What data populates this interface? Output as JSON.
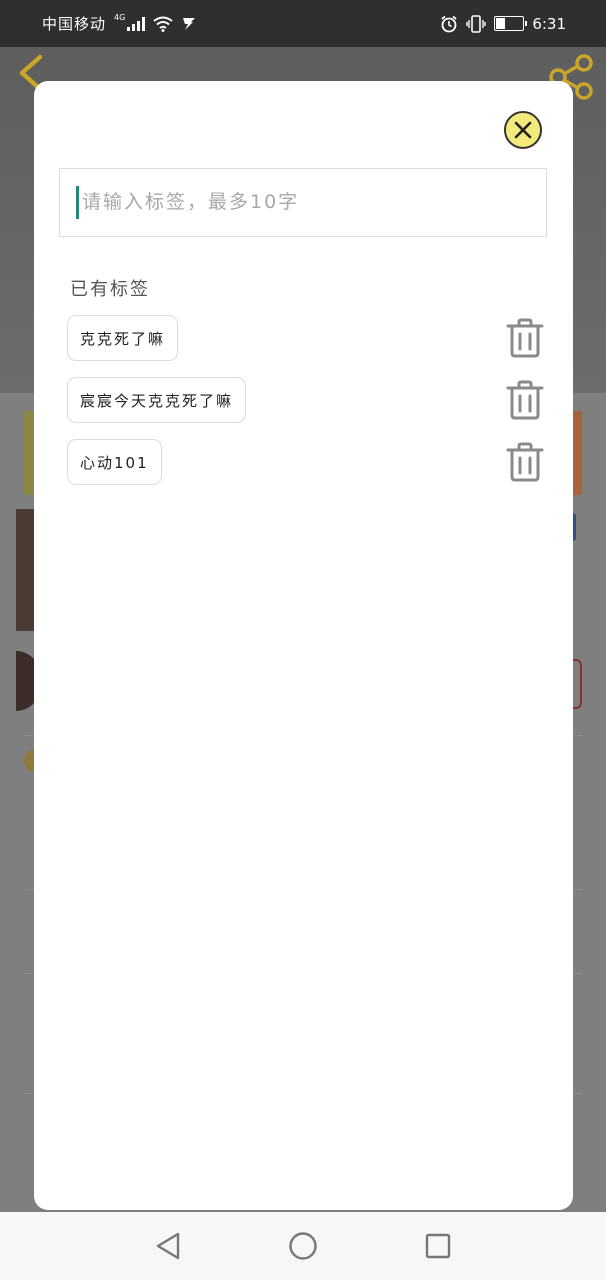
{
  "status_bar": {
    "carrier": "中国移动",
    "network": "4G",
    "time": "6:31",
    "battery_level": 0.3
  },
  "header": {
    "back_icon": "chevron-left-icon",
    "share_icon": "share-icon",
    "accent_color": "#f4c21a"
  },
  "modal": {
    "close_icon": "close-icon",
    "close_color": "#f2eb7c",
    "input": {
      "value": "",
      "placeholder": "请输入标签，最多10字"
    },
    "existing_title": "已有标签",
    "tags": [
      {
        "label": "克克死了嘛"
      },
      {
        "label": "宸宸今天克克死了嘛"
      },
      {
        "label": "心动101"
      }
    ],
    "delete_icon": "trash-icon"
  },
  "nav_bar": {
    "items": [
      "back-triangle-icon",
      "home-circle-icon",
      "recents-square-icon"
    ]
  }
}
